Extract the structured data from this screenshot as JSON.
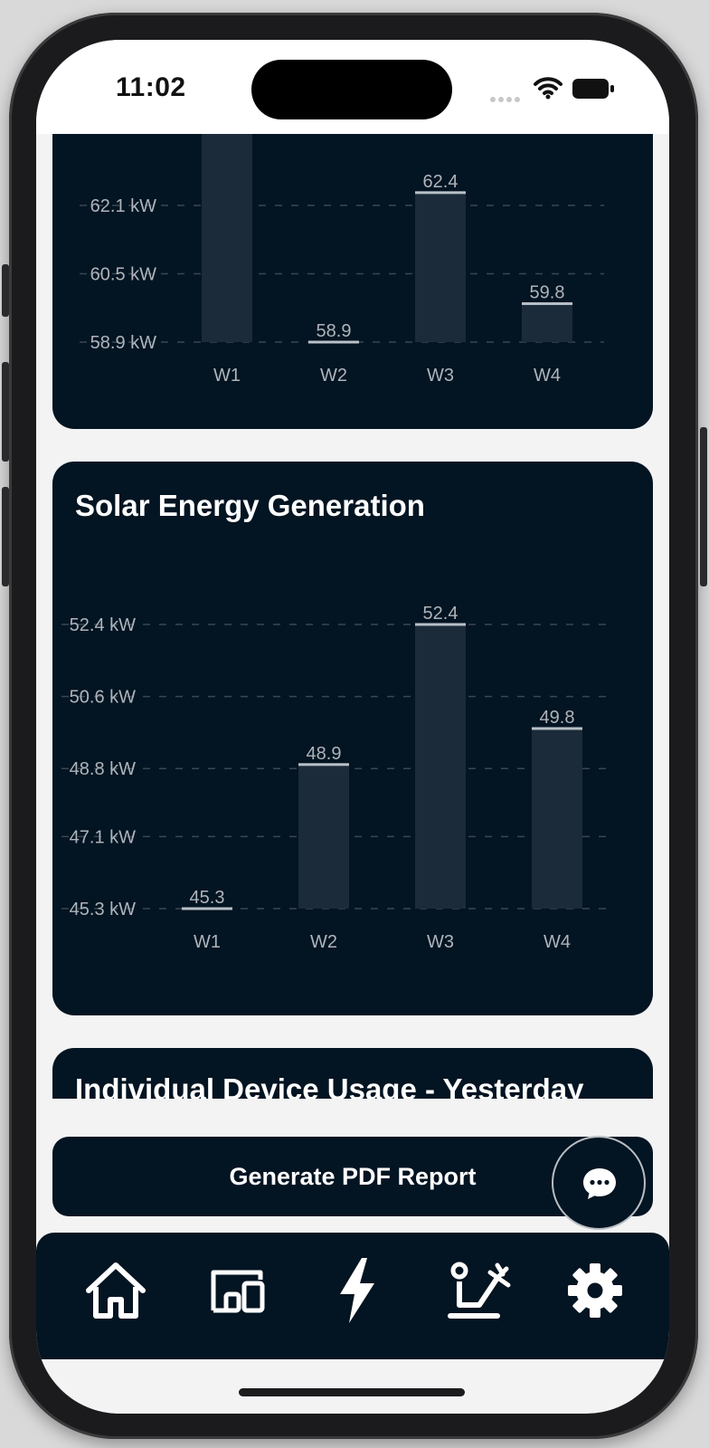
{
  "status_bar": {
    "time": "11:02"
  },
  "top_chart": {
    "chart_data": {
      "type": "bar",
      "categories": [
        "W1",
        "W2",
        "W3",
        "W4"
      ],
      "values": [
        64.5,
        58.9,
        62.4,
        59.8
      ],
      "data_labels": [
        "",
        "58.9",
        "62.4",
        "59.8"
      ],
      "y_ticks": [
        58.9,
        60.5,
        62.1
      ],
      "y_tick_labels": [
        "58.9 kW",
        "60.5 kW",
        "62.1 kW"
      ],
      "ylim": [
        58.9,
        62.1
      ],
      "grid": true
    }
  },
  "solar_card": {
    "title": "Solar Energy Generation",
    "chart_data": {
      "type": "bar",
      "title": "Solar Energy Generation",
      "categories": [
        "W1",
        "W2",
        "W3",
        "W4"
      ],
      "values": [
        45.3,
        48.9,
        52.4,
        49.8
      ],
      "data_labels": [
        "45.3",
        "48.9",
        "52.4",
        "49.8"
      ],
      "y_ticks": [
        45.3,
        47.1,
        48.8,
        50.6,
        52.4
      ],
      "y_tick_labels": [
        "45.3 kW",
        "47.1 kW",
        "48.8 kW",
        "50.6 kW",
        "52.4 kW"
      ],
      "ylim": [
        45.3,
        52.4
      ],
      "grid": true
    }
  },
  "device_card": {
    "title": "Individual Device Usage - Yesterday"
  },
  "pdf_button": {
    "label": "Generate PDF Report"
  },
  "chat_fab": {
    "icon": "chat-bubble-icon"
  },
  "nav": {
    "items": [
      {
        "icon": "home-icon"
      },
      {
        "icon": "devices-icon"
      },
      {
        "icon": "energy-bolt-icon"
      },
      {
        "icon": "solar-panel-icon"
      },
      {
        "icon": "gear-icon"
      }
    ]
  },
  "colors": {
    "card_bg": "#031422",
    "bar_fill": "#1c2b39",
    "bar_cap": "#b8c0c8",
    "axis_text": "#aeb4ba",
    "grid": "#3a4653",
    "page_bg": "#f3f3f4"
  }
}
